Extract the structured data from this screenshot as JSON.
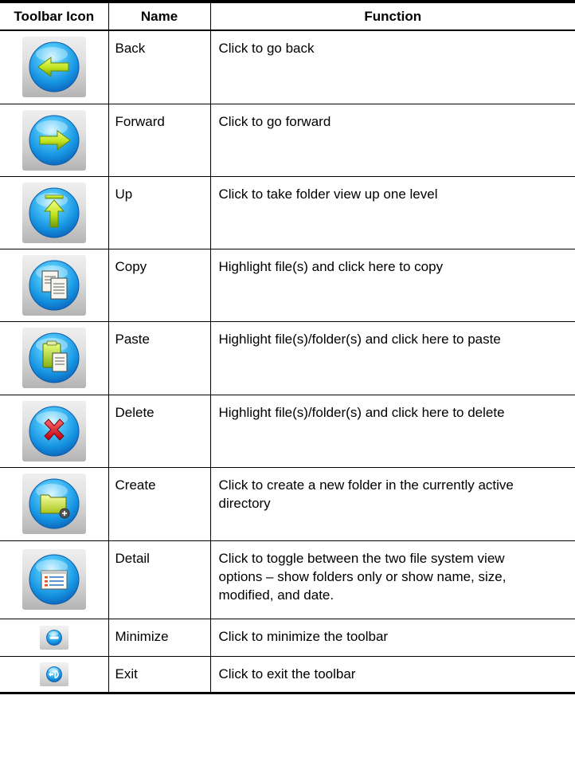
{
  "headers": {
    "icon": "Toolbar Icon",
    "name": "Name",
    "function": "Function"
  },
  "rows": [
    {
      "name": "Back",
      "function": "Click to go back",
      "icon": "back-arrow-icon"
    },
    {
      "name": "Forward",
      "function": "Click to go forward",
      "icon": "forward-arrow-icon"
    },
    {
      "name": "Up",
      "function": "Click to take folder view up one level",
      "icon": "up-arrow-icon"
    },
    {
      "name": "Copy",
      "function": "Highlight file(s) and click here to copy",
      "icon": "copy-icon"
    },
    {
      "name": "Paste",
      "function": "Highlight file(s)/folder(s) and click here to paste",
      "icon": "paste-icon"
    },
    {
      "name": "Delete",
      "function": "Highlight file(s)/folder(s) and click here to delete",
      "icon": "delete-icon"
    },
    {
      "name": "Create",
      "function": "Click to create a new folder in the currently active directory",
      "icon": "create-folder-icon"
    },
    {
      "name": "Detail",
      "function": "Click to toggle between the two file system view options – show folders only or show name, size, modified, and date.",
      "icon": "detail-view-icon"
    },
    {
      "name": "Minimize",
      "function": "Click to minimize the toolbar",
      "icon": "minimize-icon"
    },
    {
      "name": "Exit",
      "function": "Click to exit the toolbar",
      "icon": "exit-icon"
    }
  ],
  "colors": {
    "orb_light": "#7fd9ff",
    "orb_mid": "#1ea8ee",
    "orb_dark": "#0b62b8",
    "arrow_green": "#b8e41e",
    "delete_red": "#e0141e"
  }
}
